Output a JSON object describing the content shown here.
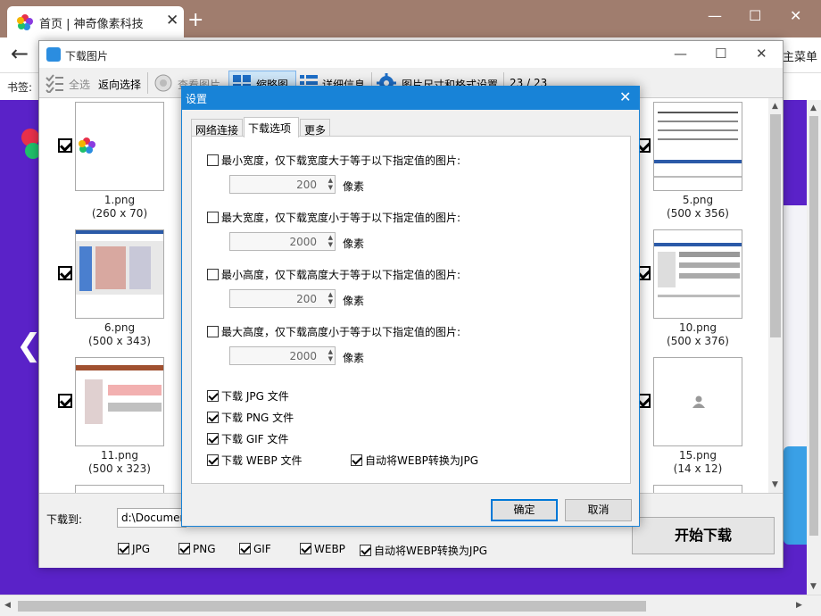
{
  "browser": {
    "tab_title": "首页 | 神奇像素科技",
    "new_tab": "+",
    "minimize": "—",
    "maximize": "☐",
    "close": "✕",
    "back": "←",
    "menu": "主菜单",
    "bookmarks_label": "书签:"
  },
  "download_window": {
    "title": "下载图片",
    "toolbar": {
      "select_all": "全选",
      "invert_select": "返向选择",
      "view_image": "查看图片",
      "thumbnail": "缩略图",
      "details": "详细信息",
      "size_format_settings": "图片尺寸和格式设置",
      "count": "23 / 23"
    },
    "thumbnails": [
      {
        "name": "1.png",
        "size": "(260 x 70)"
      },
      {
        "name": "5.png",
        "size": "(500 x 356)"
      },
      {
        "name": "6.png",
        "size": "(500 x 343)"
      },
      {
        "name": "10.png",
        "size": "(500 x 376)"
      },
      {
        "name": "11.png",
        "size": "(500 x 323)"
      },
      {
        "name": "15.png",
        "size": "(14 x 12)"
      }
    ],
    "download_to_label": "下载到:",
    "download_path": "d:\\Documents",
    "formats": {
      "jpg": "JPG",
      "png": "PNG",
      "gif": "GIF",
      "webp": "WEBP",
      "webp_convert": "自动将WEBP转换为JPG"
    },
    "start_button": "开始下载"
  },
  "settings_dialog": {
    "title": "设置",
    "close": "✕",
    "tabs": [
      "网络连接",
      "下载选项",
      "更多"
    ],
    "active_tab": "下载选项",
    "min_width": {
      "label": "最小宽度，仅下载宽度大于等于以下指定值的图片:",
      "value": "200",
      "checked": false
    },
    "max_width": {
      "label": "最大宽度，仅下载宽度小于等于以下指定值的图片:",
      "value": "2000",
      "checked": false
    },
    "min_height": {
      "label": "最小高度，仅下载高度大于等于以下指定值的图片:",
      "value": "200",
      "checked": false
    },
    "max_height": {
      "label": "最大高度，仅下载高度小于等于以下指定值的图片:",
      "value": "2000",
      "checked": false
    },
    "unit": "像素",
    "dl_jpg": {
      "label": "下载 JPG 文件",
      "checked": true
    },
    "dl_png": {
      "label": "下载 PNG 文件",
      "checked": true
    },
    "dl_gif": {
      "label": "下载 GIF 文件",
      "checked": true
    },
    "dl_webp": {
      "label": "下载 WEBP 文件",
      "checked": true
    },
    "webp_to_jpg": {
      "label": "自动将WEBP转换为JPG",
      "checked": true
    },
    "ok_button": "确定",
    "cancel_button": "取消"
  },
  "colors": {
    "browser_titlebar": "#a07d6e",
    "page_background": "#5a22c8",
    "dialog_accent": "#1883d7"
  }
}
